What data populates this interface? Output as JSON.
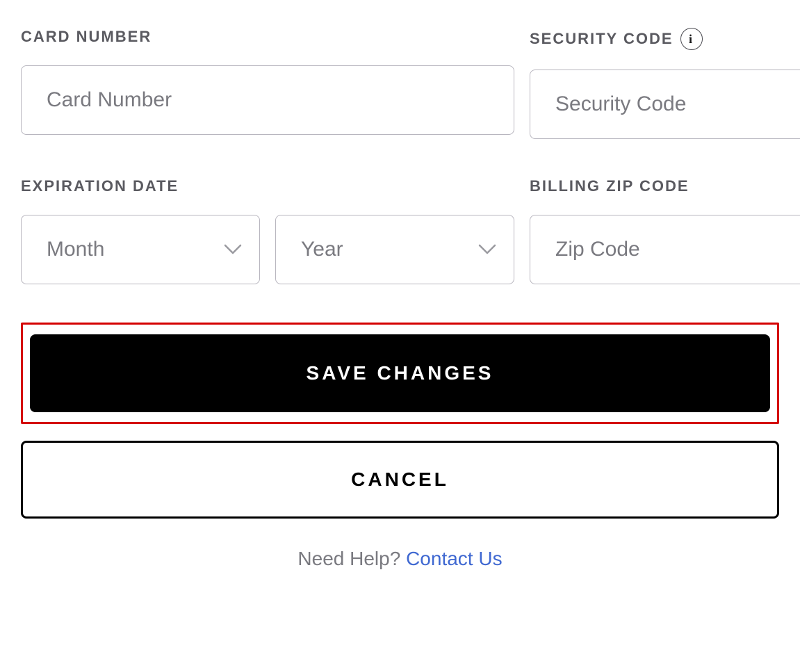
{
  "labels": {
    "cardNumber": "CARD NUMBER",
    "securityCode": "SECURITY CODE",
    "expirationDate": "EXPIRATION DATE",
    "billingZip": "BILLING ZIP CODE"
  },
  "placeholders": {
    "cardNumber": "Card Number",
    "securityCode": "Security Code",
    "month": "Month",
    "year": "Year",
    "zip": "Zip Code"
  },
  "values": {
    "cardNumber": "",
    "securityCode": "",
    "month": "",
    "year": "",
    "zip": ""
  },
  "buttons": {
    "save": "SAVE CHANGES",
    "cancel": "CANCEL"
  },
  "help": {
    "prefix": "Need Help? ",
    "linkText": "Contact Us"
  },
  "icons": {
    "info": "i"
  }
}
